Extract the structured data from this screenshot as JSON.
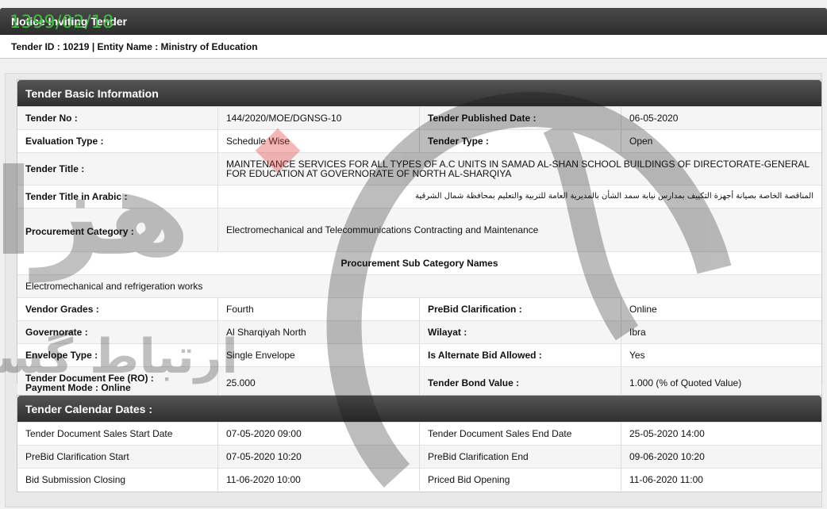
{
  "stamp": "1399/02/18",
  "header": {
    "title": "Notice Inviting Tender"
  },
  "tender_summary": "Tender ID : 10219 | Entity Name : Ministry of Education",
  "basic": {
    "heading": "Tender Basic Information",
    "tender_no_label": "Tender No :",
    "tender_no": "144/2020/MOE/DGNSG-10",
    "published_label": "Tender Published Date :",
    "published": "06-05-2020",
    "eval_label": "Evaluation Type :",
    "eval": "Schedule Wise",
    "type_label": "Tender Type :",
    "type": "Open",
    "title_label": "Tender Title :",
    "title": "MAINTENANCE SERVICES FOR ALL TYPES OF A.C UNITS IN SAMAD AL-SHAN SCHOOL BUILDINGS OF DIRECTORATE-GENERAL FOR EDUCATION AT GOVERNORATE OF NORTH AL-SHARQIYA",
    "title_ar_label": "Tender Title in Arabic :",
    "title_ar": "المناقصة الخاصة بصيانة أجهزة التكييف بمدارس نيابة سمد الشأن بالمديرية العامة للتربية والتعليم بمحافظة شمال الشرقية",
    "proc_cat_label": "Procurement Category :",
    "proc_cat": "Electromechanical and Telecommunications Contracting and Maintenance",
    "sub_cat_heading": "Procurement Sub Category Names",
    "sub_cat": "Electromechanical and refrigeration works",
    "vendor_label": "Vendor Grades :",
    "vendor": "Fourth",
    "prebid_label": "PreBid Clarification :",
    "prebid": "Online",
    "gov_label": "Governorate :",
    "gov": "Al Sharqiyah North",
    "wilayat_label": "Wilayat :",
    "wilayat": "Ibra",
    "envelope_label": "Envelope Type :",
    "envelope": "Single Envelope",
    "alt_bid_label": "Is Alternate Bid Allowed :",
    "alt_bid": "Yes",
    "fee_label": "Tender Document Fee (RO) :",
    "payment_label": "Payment Mode :  Online",
    "fee": "25.000",
    "bond_label": "Tender Bond Value :",
    "bond": "1.000 (% of Quoted Value)"
  },
  "calendar": {
    "heading": "Tender Calendar Dates :",
    "rows": [
      {
        "l1": "Tender Document Sales Start Date",
        "v1": "07-05-2020 09:00",
        "l2": "Tender Document Sales End Date",
        "v2": "25-05-2020 14:00"
      },
      {
        "l1": "PreBid Clarification Start",
        "v1": "07-05-2020 10:20",
        "l2": "PreBid Clarification End",
        "v2": "09-06-2020 10:20"
      },
      {
        "l1": "Bid Submission Closing",
        "v1": "11-06-2020 10:00",
        "l2": "Priced Bid Opening",
        "v2": "11-06-2020 11:00"
      }
    ]
  },
  "watermark_text": "هزاره",
  "watermark_sub": "ارتباط گستران"
}
